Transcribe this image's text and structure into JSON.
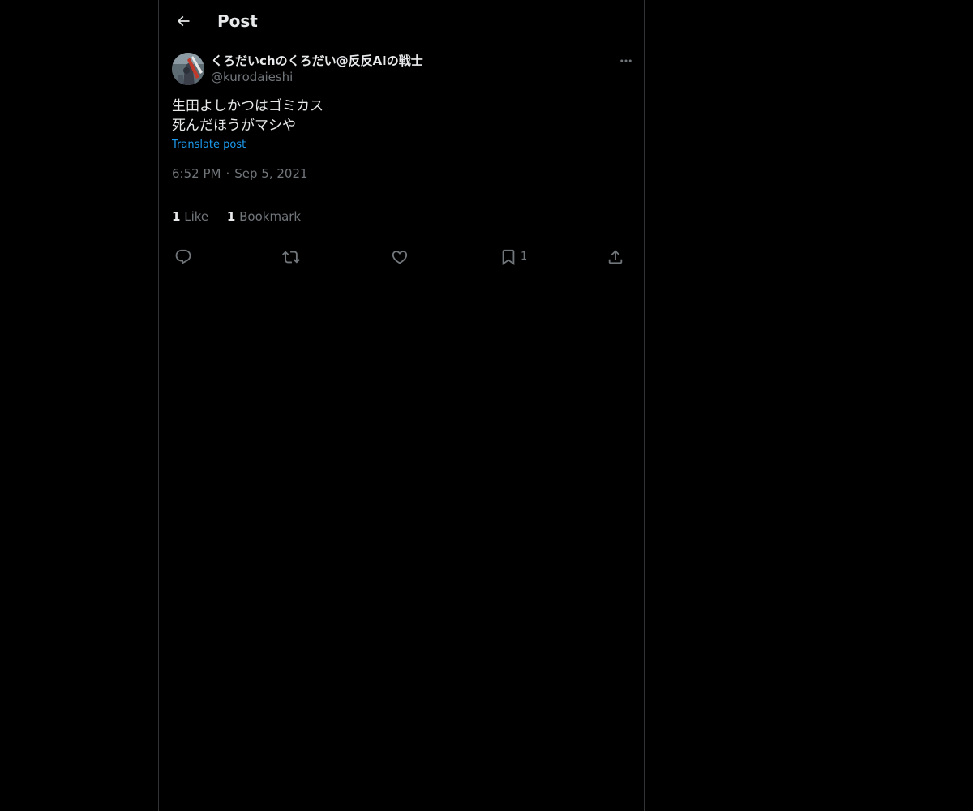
{
  "header": {
    "title": "Post"
  },
  "post": {
    "author": {
      "display_name": "くろだいchのくろだい@反反AIの戦士",
      "handle": "@kurodaieshi"
    },
    "text": "生田よしかつはゴミカス\n死んだほうがマシや",
    "translate_label": "Translate post",
    "time": "6:52 PM",
    "separator": "·",
    "date": "Sep 5, 2021",
    "stats": {
      "likes_count": "1",
      "likes_label": "Like",
      "bookmarks_count": "1",
      "bookmarks_label": "Bookmark"
    },
    "actions": {
      "bookmark_count": "1"
    }
  },
  "icons": {
    "back": "arrow-left-icon",
    "more": "more-horizontal-icon",
    "reply": "reply-icon",
    "repost": "repost-icon",
    "like": "heart-icon",
    "bookmark": "bookmark-icon",
    "share": "share-icon"
  },
  "colors": {
    "background": "#000000",
    "text_primary": "#e7e9ea",
    "text_secondary": "#71767b",
    "link": "#1d9bf0",
    "border": "#2f3336"
  }
}
